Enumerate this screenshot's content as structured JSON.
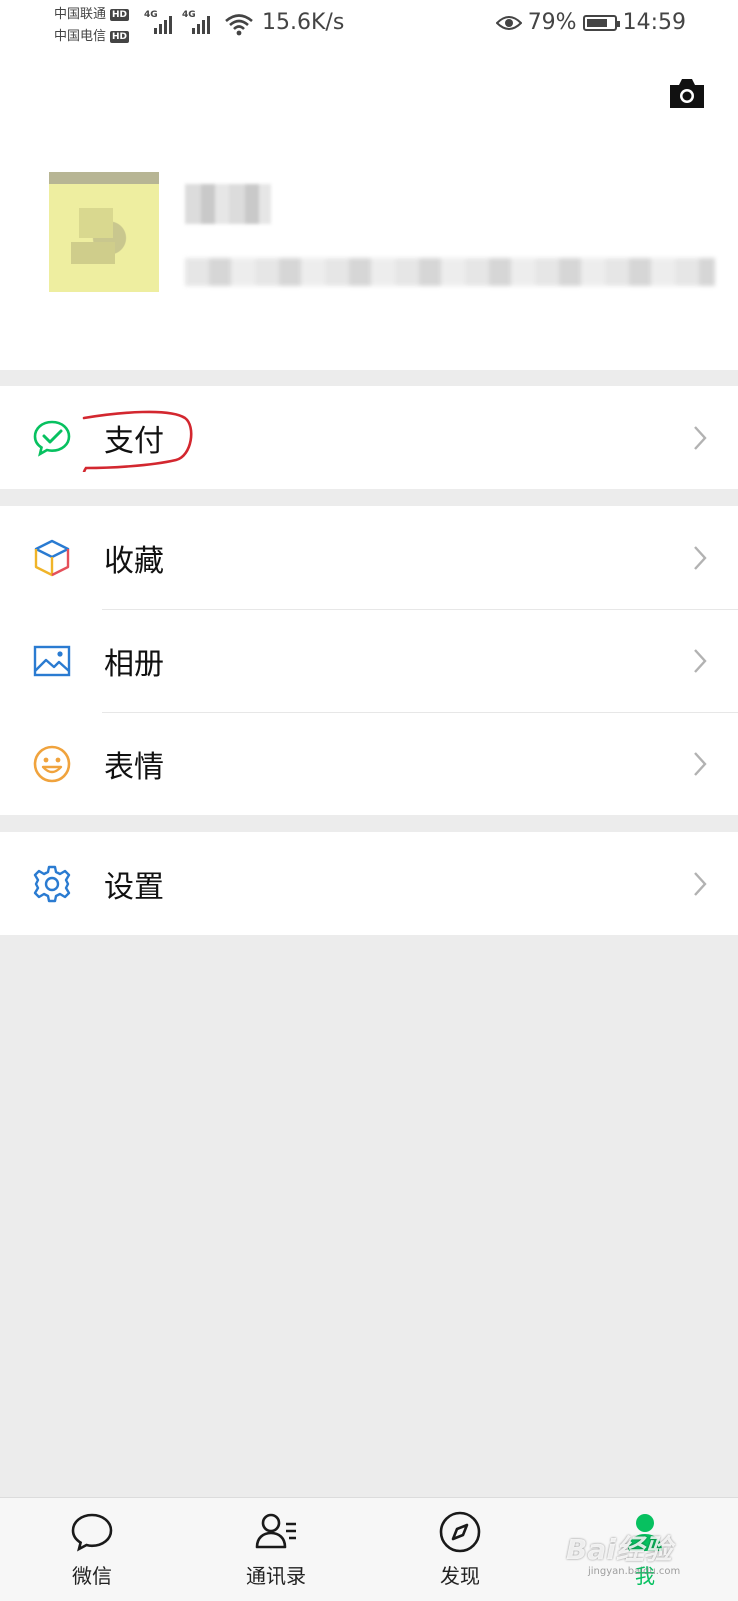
{
  "status_bar": {
    "carrier_1": "中国联通",
    "carrier_2": "中国电信",
    "hd": "HD",
    "network_type": "4G",
    "speed": "15.6K/s",
    "battery_percent": "79%",
    "battery_level": 0.79,
    "time": "14:59"
  },
  "profile": {
    "camera_icon": "camera-icon",
    "avatar": "avatar-blurred",
    "nickname_blurred": true,
    "wechat_id_blurred": true
  },
  "menu": {
    "pay": {
      "label": "支付",
      "icon": "wechat-pay-icon",
      "accent": "#07c160",
      "annotation_color": "#d3272f"
    },
    "favorites": {
      "label": "收藏",
      "icon": "cube-icon"
    },
    "album": {
      "label": "相册",
      "icon": "picture-icon",
      "accent": "#2a7bd1"
    },
    "stickers": {
      "label": "表情",
      "icon": "smile-icon",
      "accent": "#f0a33d"
    },
    "settings": {
      "label": "设置",
      "icon": "gear-icon",
      "accent": "#2a7bd1"
    }
  },
  "tabbar": {
    "tabs": [
      {
        "label": "微信",
        "icon": "chat-bubble-icon"
      },
      {
        "label": "通讯录",
        "icon": "contacts-icon"
      },
      {
        "label": "发现",
        "icon": "compass-icon"
      },
      {
        "label": "我",
        "icon": "person-icon",
        "active": true
      }
    ],
    "active_color": "#07c160"
  },
  "watermark": {
    "text": "Bai经验",
    "sub": "jingyan.baidu.com"
  }
}
